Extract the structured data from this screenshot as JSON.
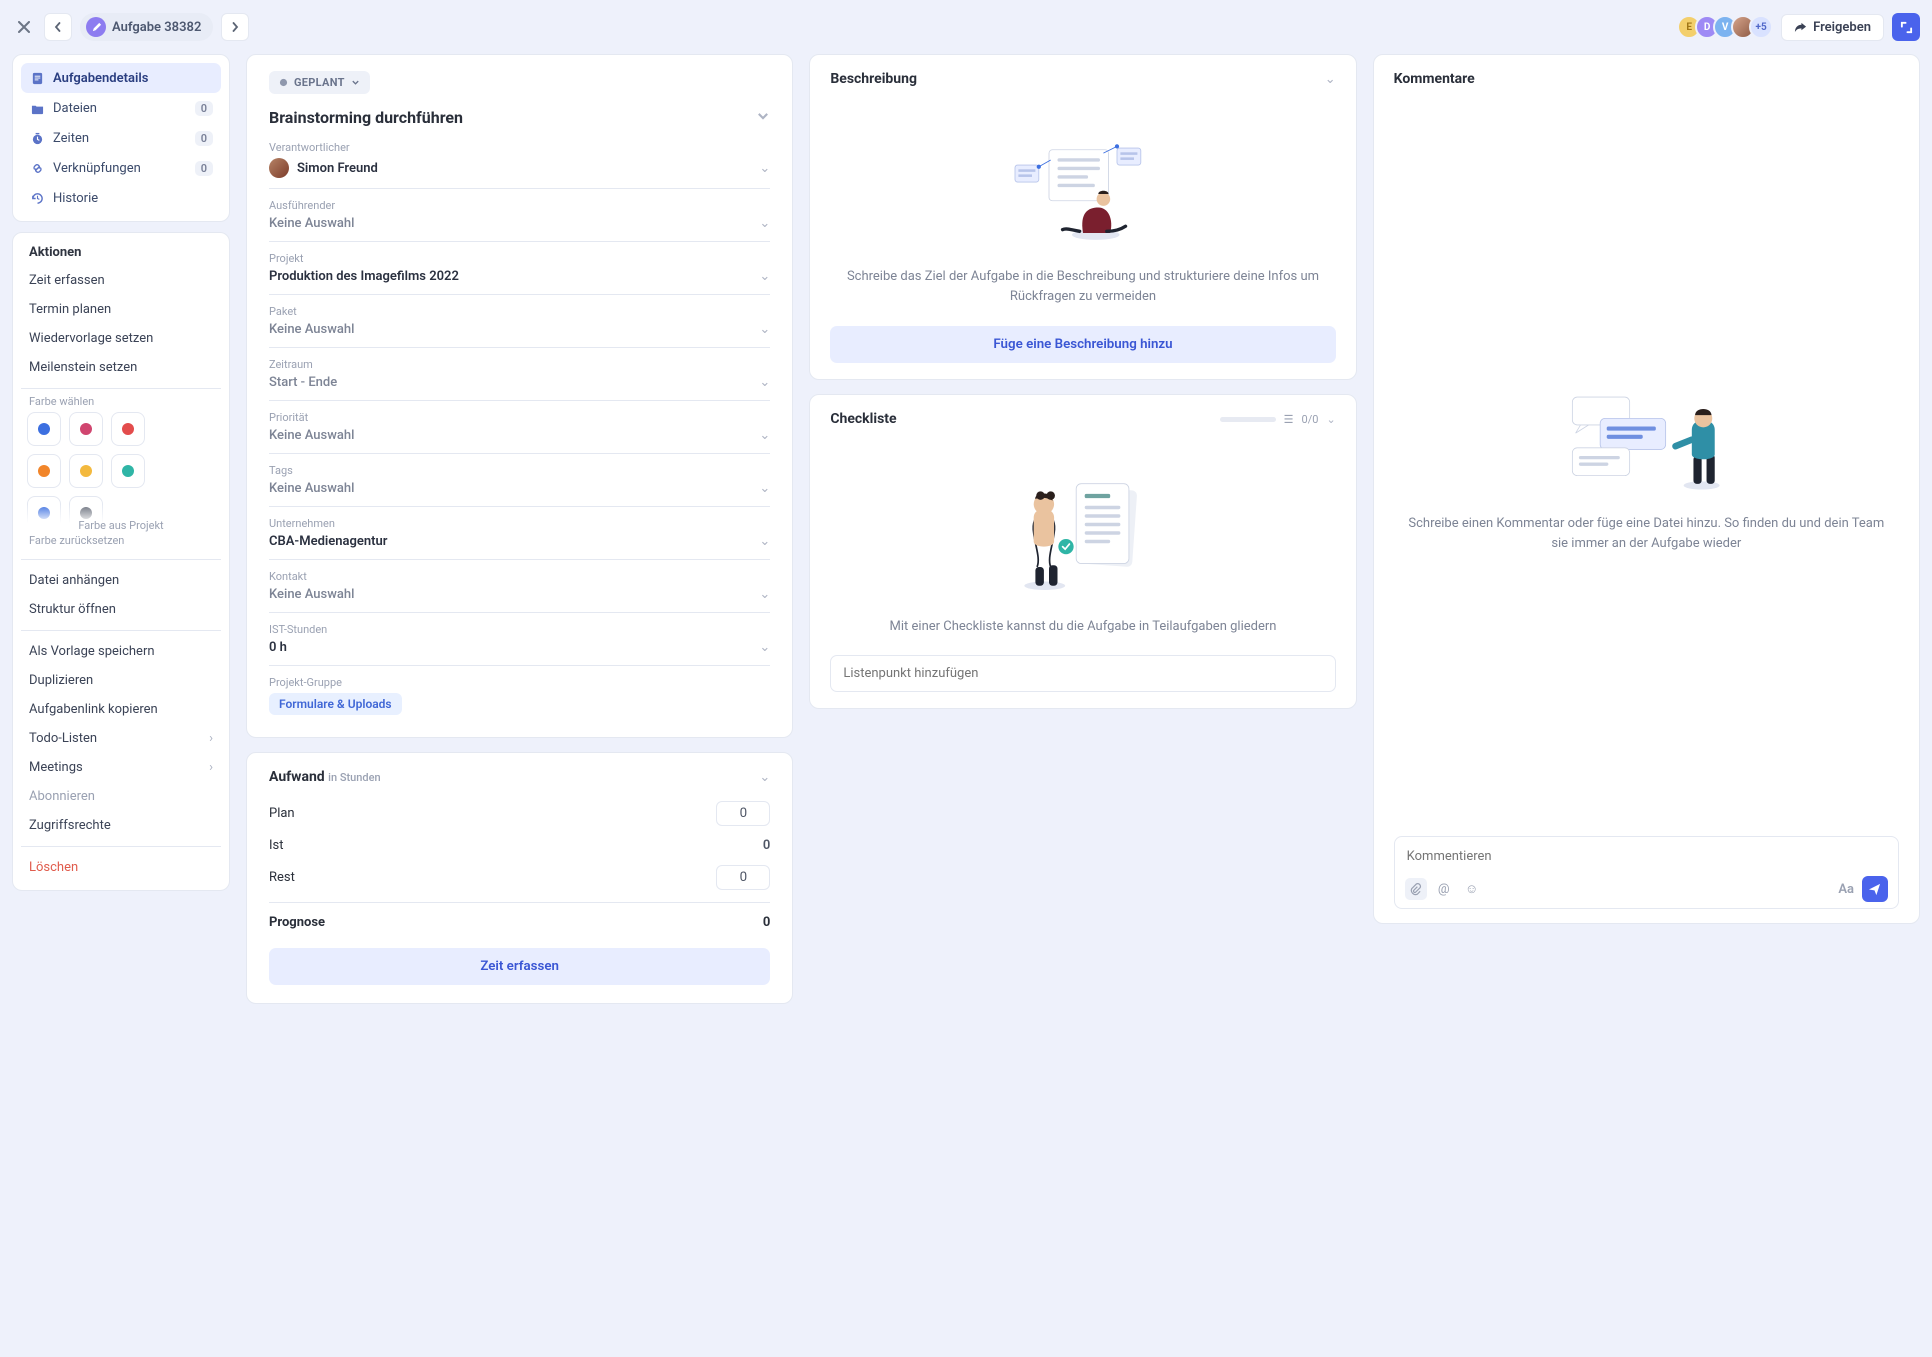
{
  "header": {
    "breadcrumb": "Aufgabe 38382",
    "share_label": "Freigeben",
    "avatars_extra": "+5",
    "avatars": [
      "E",
      "D",
      "V"
    ]
  },
  "sidebar": {
    "nav": [
      {
        "label": "Aufgabendetails",
        "icon": "doc",
        "active": true
      },
      {
        "label": "Dateien",
        "icon": "folder",
        "badge": "0"
      },
      {
        "label": "Zeiten",
        "icon": "timer",
        "badge": "0"
      },
      {
        "label": "Verknüpfungen",
        "icon": "link",
        "badge": "0"
      },
      {
        "label": "Historie",
        "icon": "history"
      }
    ],
    "actions_title": "Aktionen",
    "actions_primary": [
      "Zeit erfassen",
      "Termin planen",
      "Wiedervorlage setzen",
      "Meilenstein setzen"
    ],
    "color_label": "Farbe wählen",
    "color_fade_label": "Farbe aus Projekt",
    "color_reset": "Farbe zurücksetzen",
    "actions_secondary": [
      "Datei anhängen",
      "Struktur öffnen"
    ],
    "actions_tertiary": [
      {
        "label": "Als Vorlage speichern"
      },
      {
        "label": "Duplizieren"
      },
      {
        "label": "Aufgabenlink kopieren"
      },
      {
        "label": "Todo-Listen",
        "chevron": true
      },
      {
        "label": "Meetings",
        "chevron": true
      },
      {
        "label": "Abonnieren",
        "muted": true
      },
      {
        "label": "Zugriffsrechte"
      }
    ],
    "delete": "Löschen"
  },
  "form": {
    "status": "GEPLANT",
    "title": "Brainstorming durchführen",
    "fields": {
      "responsible_label": "Verantwortlicher",
      "responsible_value": "Simon Freund",
      "executor_label": "Ausführender",
      "executor_value": "Keine Auswahl",
      "project_label": "Projekt",
      "project_value": "Produktion des Imagefilms 2022",
      "package_label": "Paket",
      "package_value": "Keine Auswahl",
      "period_label": "Zeitraum",
      "period_value": "Start - Ende",
      "priority_label": "Priorität",
      "priority_value": "Keine Auswahl",
      "tags_label": "Tags",
      "tags_value": "Keine Auswahl",
      "company_label": "Unternehmen",
      "company_value": "CBA-Medienagentur",
      "contact_label": "Kontakt",
      "contact_value": "Keine Auswahl",
      "actual_label": "IST-Stunden",
      "actual_value": "0 h",
      "group_label": "Projekt-Gruppe",
      "group_value": "Formulare & Uploads"
    }
  },
  "effort": {
    "title": "Aufwand",
    "subtitle": "in Stunden",
    "plan_label": "Plan",
    "plan_value": "0",
    "ist_label": "Ist",
    "ist_value": "0",
    "rest_label": "Rest",
    "rest_value": "0",
    "prognose_label": "Prognose",
    "prognose_value": "0",
    "button": "Zeit erfassen"
  },
  "description": {
    "title": "Beschreibung",
    "empty": "Schreibe das Ziel der Aufgabe in die Beschreibung und strukturiere deine Infos um Rückfragen zu vermeiden",
    "button": "Füge eine Beschreibung hinzu"
  },
  "checklist": {
    "title": "Checkliste",
    "counter": "0/0",
    "empty": "Mit einer Checkliste kannst du die Aufgabe in Teilaufgaben gliedern",
    "placeholder": "Listenpunkt hinzufügen"
  },
  "comments": {
    "title": "Kommentare",
    "empty": "Schreibe einen Kommentar oder füge eine Datei hinzu. So finden du und dein Team sie immer an der Aufgabe wieder",
    "placeholder": "Kommentieren",
    "format_label": "Aa"
  },
  "colors": [
    "#3c6fe0",
    "#d0456f",
    "#e34c4c",
    "#f1852a",
    "#f3b93e",
    "#2fb5a6",
    "#3c6fe0",
    "#666c79"
  ]
}
